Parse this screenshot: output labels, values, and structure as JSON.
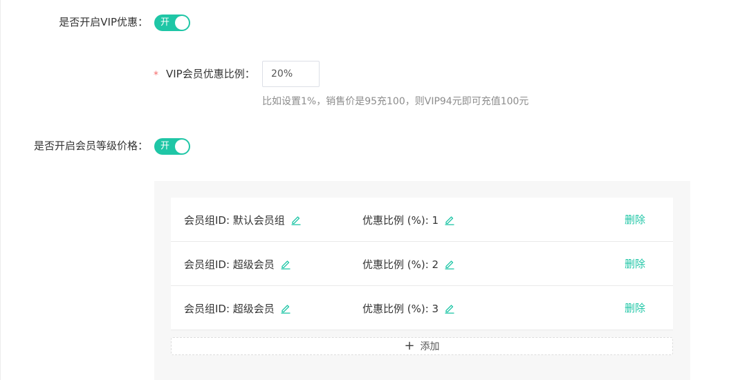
{
  "vip_discount": {
    "label": "是否开启VIP优惠：",
    "switch_text": "开",
    "ratio_label": "VIP会员优惠比例：",
    "required_mark": "*",
    "ratio_value": "20%",
    "help_text": "比如设置1%，销售价是95充100，则VIP94元即可充值100元"
  },
  "member_level_price": {
    "label": "是否开启会员等级价格：",
    "switch_text": "开"
  },
  "member_groups": [
    {
      "id_text": "会员组ID: 默认会员组",
      "ratio_text": "优惠比例 (%): 1",
      "delete_label": "删除"
    },
    {
      "id_text": "会员组ID: 超级会员",
      "ratio_text": "优惠比例 (%): 2",
      "delete_label": "删除"
    },
    {
      "id_text": "会员组ID: 超级会员",
      "ratio_text": "优惠比例 (%): 3",
      "delete_label": "删除"
    }
  ],
  "add_button": {
    "label": "添加",
    "icon": "plus-icon"
  },
  "colors": {
    "accent": "#1fc6a6",
    "required": "#f56c6c",
    "panel_bg": "#f7f7f7"
  }
}
